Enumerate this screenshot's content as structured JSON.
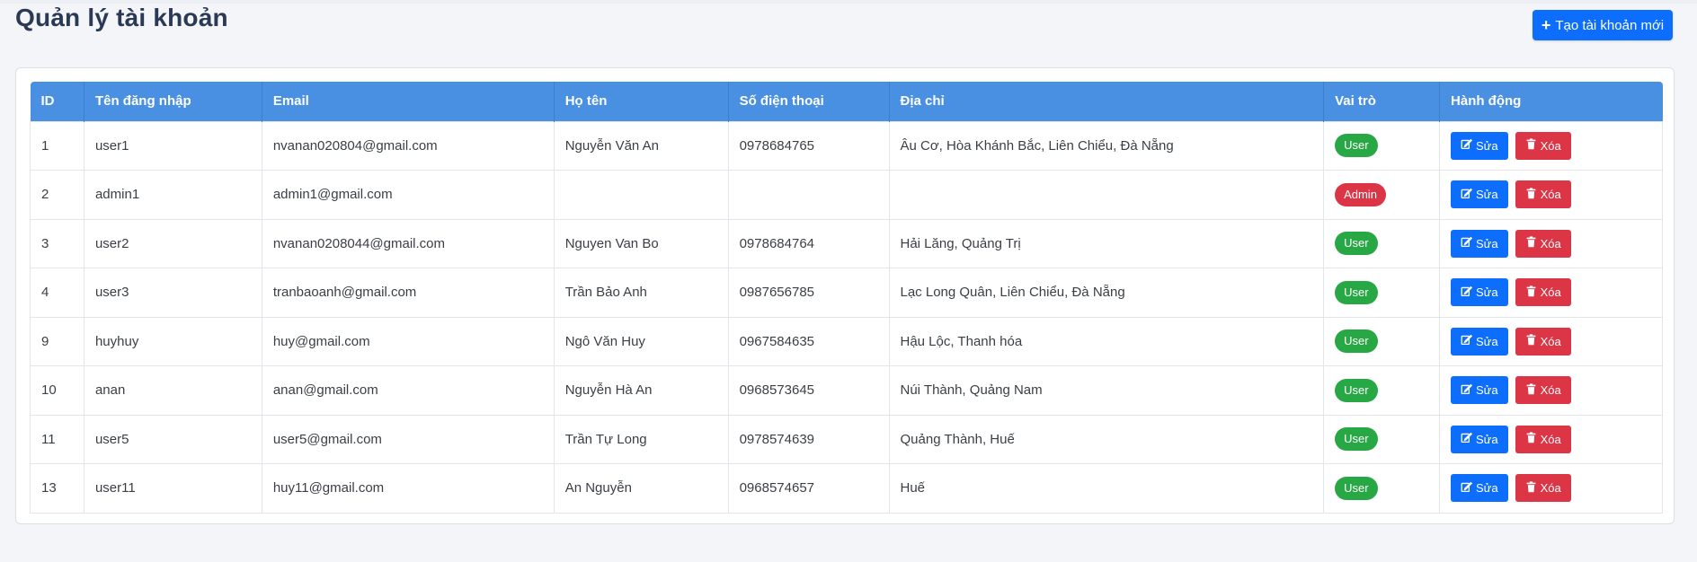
{
  "page": {
    "title": "Quản lý tài khoản",
    "create_button_label": "Tạo tài khoản mới"
  },
  "colors": {
    "header_bg": "#4a90e2",
    "primary": "#0d6efd",
    "danger": "#dc3545",
    "success": "#28a745"
  },
  "table": {
    "headers": [
      "ID",
      "Tên đăng nhập",
      "Email",
      "Họ tên",
      "Số điện thoại",
      "Địa chỉ",
      "Vai trò",
      "Hành động"
    ],
    "edit_label": "Sửa",
    "delete_label": "Xóa",
    "rows": [
      {
        "id": "1",
        "username": "user1",
        "email": "nvanan020804@gmail.com",
        "fullname": "Nguyễn Văn An",
        "phone": "0978684765",
        "address": "Âu Cơ, Hòa Khánh Bắc, Liên Chiểu, Đà Nẵng",
        "role": "User"
      },
      {
        "id": "2",
        "username": "admin1",
        "email": "admin1@gmail.com",
        "fullname": "",
        "phone": "",
        "address": "",
        "role": "Admin"
      },
      {
        "id": "3",
        "username": "user2",
        "email": "nvanan0208044@gmail.com",
        "fullname": "Nguyen Van Bo",
        "phone": "0978684764",
        "address": "Hải Lăng, Quảng Trị",
        "role": "User"
      },
      {
        "id": "4",
        "username": "user3",
        "email": "tranbaoanh@gmail.com",
        "fullname": "Trần Bảo Anh",
        "phone": "0987656785",
        "address": "Lạc Long Quân, Liên Chiểu, Đà Nẵng",
        "role": "User"
      },
      {
        "id": "9",
        "username": "huyhuy",
        "email": "huy@gmail.com",
        "fullname": "Ngô Văn Huy",
        "phone": "0967584635",
        "address": "Hậu Lộc, Thanh hóa",
        "role": "User"
      },
      {
        "id": "10",
        "username": "anan",
        "email": "anan@gmail.com",
        "fullname": "Nguyễn Hà An",
        "phone": "0968573645",
        "address": "Núi Thành, Quảng Nam",
        "role": "User"
      },
      {
        "id": "11",
        "username": "user5",
        "email": "user5@gmail.com",
        "fullname": "Trần Tự Long",
        "phone": "0978574639",
        "address": "Quảng Thành, Huế",
        "role": "User"
      },
      {
        "id": "13",
        "username": "user11",
        "email": "huy11@gmail.com",
        "fullname": "An Nguyễn",
        "phone": "0968574657",
        "address": "Huế",
        "role": "User"
      }
    ]
  }
}
